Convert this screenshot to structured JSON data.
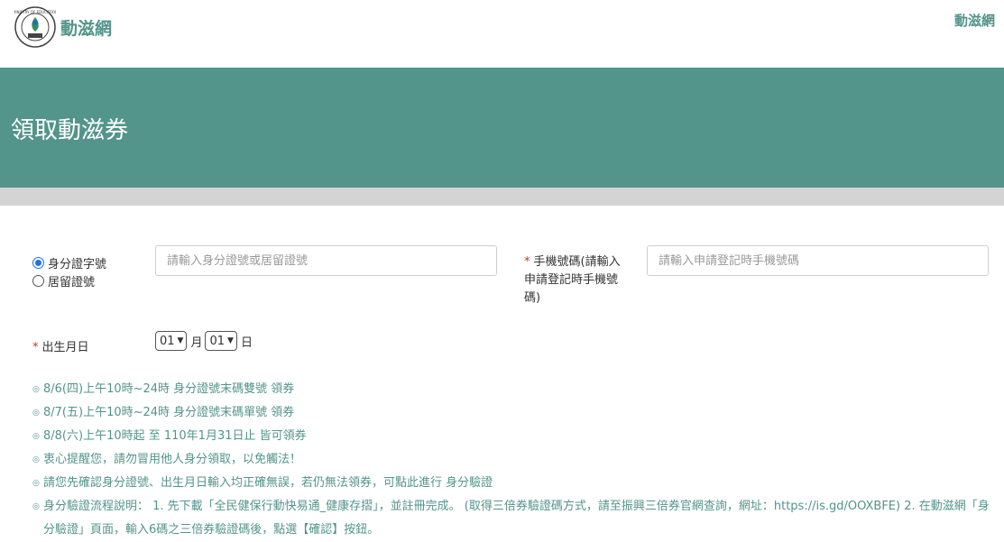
{
  "header": {
    "logo_text": "MINISTRY OF EDUCATION 教育部",
    "brand": "動滋網",
    "nav_link": "動滋網"
  },
  "banner": {
    "title": "領取動滋券"
  },
  "form": {
    "id_type_options": [
      {
        "label": "身分證字號",
        "checked": true
      },
      {
        "label": "居留證號",
        "checked": false
      }
    ],
    "id_placeholder": "請輸入身分證號或居留證號",
    "phone_required_mark": "*",
    "phone_label": "手機號碼(請輸入申請登記時手機號碼)",
    "phone_placeholder": "請輸入申請登記時手機號碼",
    "dob_required_mark": "*",
    "dob_label": "出生月日",
    "month_value": "01",
    "month_unit": "月",
    "day_value": "01",
    "day_unit": "日"
  },
  "notes": {
    "bullet": "◎",
    "items": [
      "8/6(四)上午10時~24時 身分證號末碼雙號 領券",
      "8/7(五)上午10時~24時 身分證號末碼單號 領券",
      "8/8(六)上午10時起 至 110年1月31日止 皆可領券",
      "衷心提醒您，請勿冒用他人身分領取，以免觸法！",
      "請您先確認身分證號、出生月日輸入均正確無誤，若仍無法領券，可點此進行 身分驗證",
      "身分驗證流程說明： 1. 先下載「全民健保行動快易通_健康存摺」，並註冊完成。 (取得三倍券驗證碼方式，請至振興三倍券官網查詢，網址：https://is.gd/OOXBFE) 2. 在動滋網「身分驗證」頁面，輸入6碼之三倍券驗證碼後，點選【確認】按鈕。"
    ]
  },
  "colors": {
    "brand": "#53948b",
    "strip": "#d4d4d4",
    "required": "#c0392b",
    "radio_selected": "#1a73e8"
  }
}
